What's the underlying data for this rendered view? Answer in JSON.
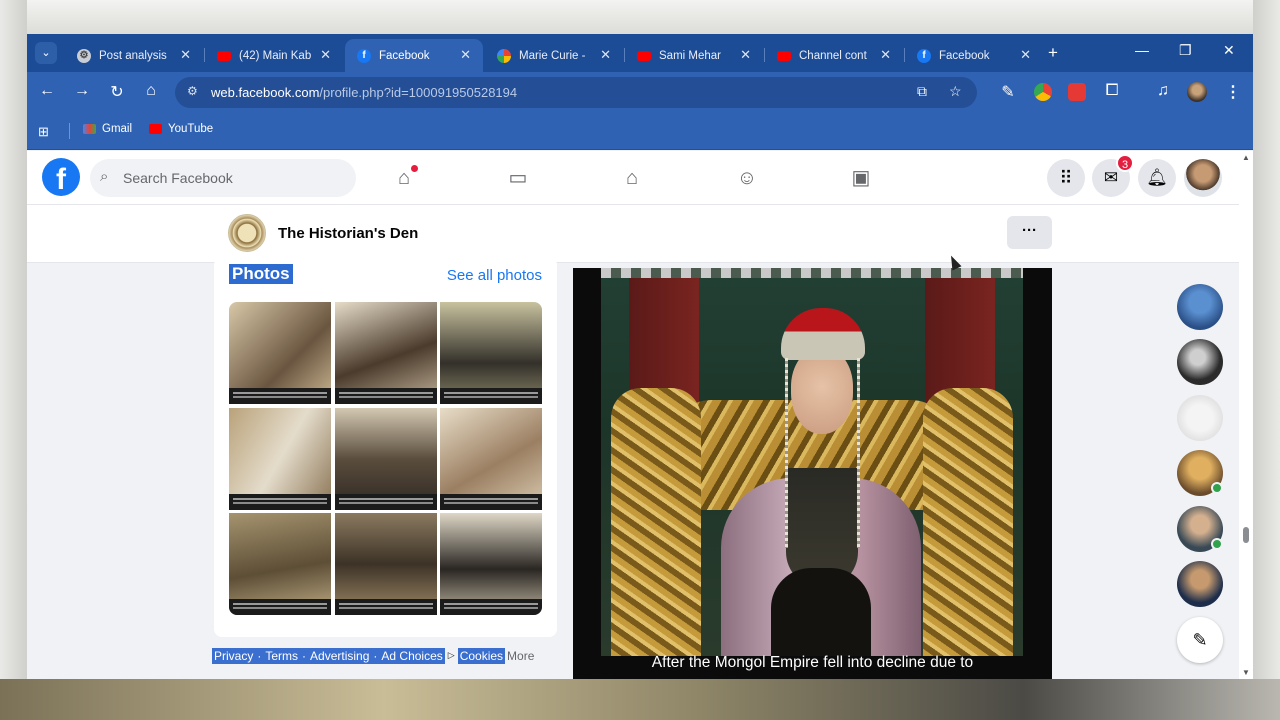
{
  "browser": {
    "tabs": [
      {
        "title": "Post analysis",
        "icon": "gear-icon"
      },
      {
        "title": "(42) Main Kab",
        "icon": "youtube-icon"
      },
      {
        "title": "Facebook",
        "icon": "facebook-icon",
        "active": true
      },
      {
        "title": "Marie Curie -",
        "icon": "google-icon"
      },
      {
        "title": "Sami Mehar",
        "icon": "youtube-icon"
      },
      {
        "title": "Channel cont",
        "icon": "youtube-icon"
      },
      {
        "title": "Facebook",
        "icon": "facebook-icon"
      }
    ],
    "url_domain": "web.facebook.com",
    "url_path": "/profile.php?id=100091950528194",
    "bookmarks": [
      {
        "label": "Gmail",
        "icon": "gmail-icon"
      },
      {
        "label": "YouTube",
        "icon": "youtube-icon"
      }
    ]
  },
  "facebook": {
    "search_placeholder": "Search Facebook",
    "messenger_badge": "3",
    "nav": [
      "home-icon",
      "watch-icon",
      "marketplace-icon",
      "groups-icon",
      "gaming-icon"
    ]
  },
  "page": {
    "name": "The Historian's Den",
    "more_label": "···"
  },
  "photos": {
    "title": "Photos",
    "see_all": "See all photos"
  },
  "footer": {
    "links": [
      "Privacy",
      "Terms",
      "Advertising",
      "Ad Choices"
    ],
    "separator": "·",
    "cookies": "Cookies",
    "more": "More"
  },
  "video": {
    "subtitle": "After the Mongol Empire fell into decline due to"
  },
  "colors": {
    "browser_chrome": "#2f62b3",
    "facebook_blue": "#1877f2",
    "notification_red": "#e41e3f",
    "online_green": "#31a24c"
  }
}
